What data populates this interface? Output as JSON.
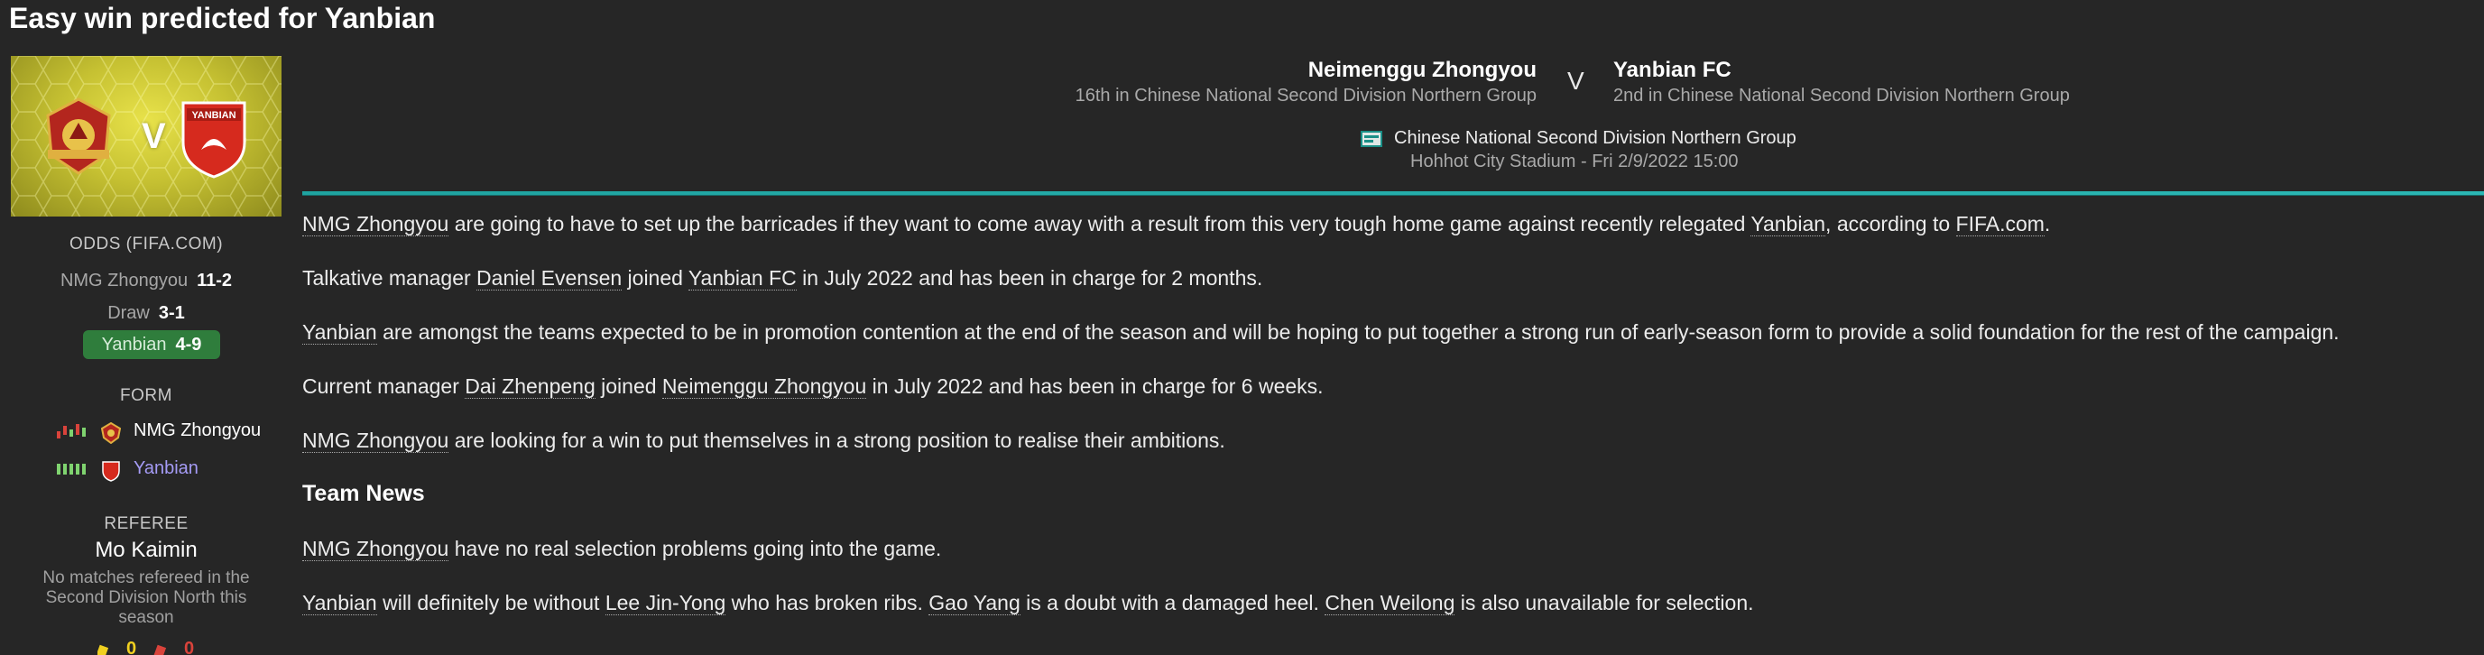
{
  "headline": "Easy win predicted for Yanbian",
  "banner": {
    "vs_letter": "V"
  },
  "odds": {
    "heading": "ODDS (FIFA.COM)",
    "rows": [
      {
        "team": "NMG Zhongyou",
        "value": "11-2"
      },
      {
        "team": "Draw",
        "value": "3-1"
      },
      {
        "team": "Yanbian",
        "value": "4-9",
        "favourite": true
      }
    ]
  },
  "form": {
    "heading": "FORM",
    "teams": [
      {
        "name": "NMG Zhongyou",
        "color": "#ffffff"
      },
      {
        "name": "Yanbian",
        "color": "#a59bf5"
      }
    ]
  },
  "referee": {
    "heading": "REFEREE",
    "name": "Mo Kaimin",
    "note": [
      "No matches refereed in the",
      "Second Division North this",
      "season"
    ],
    "yellow": "0",
    "red": "0"
  },
  "match": {
    "home_name": "Neimenggu Zhongyou",
    "home_pos": "16th in Chinese National Second Division Northern Group",
    "vs": "V",
    "away_name": "Yanbian FC",
    "away_pos": "2nd in Chinese National Second Division Northern Group",
    "competition": "Chinese National Second Division Northern Group",
    "venue": "Hohhot City Stadium - Fri 2/9/2022 15:00"
  },
  "article": {
    "p1": {
      "a": "NMG Zhongyou",
      "b": " are going to have to set up the barricades if they want to come away with a result from this very tough home game against recently relegated ",
      "c": "Yanbian",
      "d": ", according to ",
      "e": "FIFA.com",
      "f": "."
    },
    "p2": {
      "a": "Talkative manager ",
      "b": "Daniel Evensen",
      "c": " joined ",
      "d": "Yanbian FC",
      "e": " in July 2022 and has been in charge for 2 months."
    },
    "p3": {
      "a": "Yanbian",
      "b": " are amongst the teams expected to be in promotion contention at the end of the season and will be hoping to put together a strong run of early-season form to provide a solid foundation for the rest of the campaign."
    },
    "p4": {
      "a": "Current manager ",
      "b": "Dai Zhenpeng",
      "c": " joined ",
      "d": "Neimenggu Zhongyou",
      "e": " in July 2022 and has been in charge for 6 weeks."
    },
    "p5": {
      "a": "NMG Zhongyou",
      "b": " are looking for a win to put themselves in a strong position to realise their ambitions."
    },
    "team_news_heading": "Team News",
    "p6": {
      "a": "NMG Zhongyou",
      "b": " have no real selection problems going into the game."
    },
    "p7": {
      "a": "Yanbian",
      "b": " will definitely be without ",
      "c": "Lee Jin-Yong",
      "d": " who has broken ribs. ",
      "e": "Gao Yang",
      "f": " is a doubt with a damaged heel. ",
      "g": "Chen Weilong",
      "h": " is also unavailable for selection."
    }
  },
  "colors": {
    "accent": "#1fa3a0",
    "favourite": "#2f7d3c",
    "banner": "#d6d13a"
  }
}
